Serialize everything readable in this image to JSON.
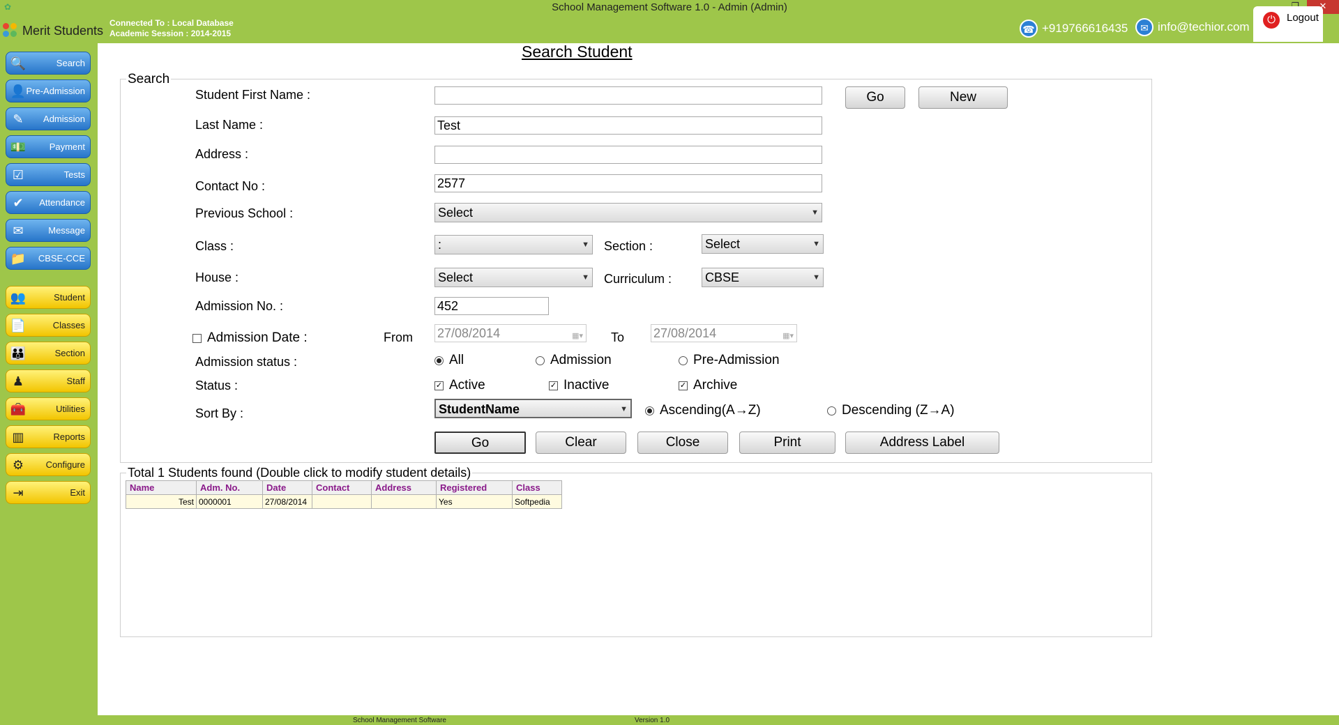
{
  "window": {
    "title": "School Management Software 1.0  -  Admin (Admin)"
  },
  "header": {
    "app_name": "Merit Students",
    "connected_to": "Connected To : Local Database",
    "session": "Academic Session : 2014-2015",
    "phone": "+919766616435",
    "email": "info@techior.com",
    "logout_label": "Logout"
  },
  "sidebar": {
    "blue_items": [
      {
        "label": "Search",
        "icon": "search-icon"
      },
      {
        "label": "Pre-Admission",
        "icon": "person-icon"
      },
      {
        "label": "Admission",
        "icon": "pencil-icon"
      },
      {
        "label": "Payment",
        "icon": "money-icon"
      },
      {
        "label": "Tests",
        "icon": "checklist-icon"
      },
      {
        "label": "Attendance",
        "icon": "attendance-icon"
      },
      {
        "label": "Message",
        "icon": "envelope-icon"
      },
      {
        "label": "CBSE-CCE",
        "icon": "folder-icon"
      }
    ],
    "yellow_items": [
      {
        "label": "Student",
        "icon": "students-icon"
      },
      {
        "label": "Classes",
        "icon": "document-icon"
      },
      {
        "label": "Section",
        "icon": "group-icon"
      },
      {
        "label": "Staff",
        "icon": "staff-icon"
      },
      {
        "label": "Utilities",
        "icon": "toolbox-icon"
      },
      {
        "label": "Reports",
        "icon": "chart-icon"
      },
      {
        "label": "Configure",
        "icon": "gear-icon"
      },
      {
        "label": "Exit",
        "icon": "exit-icon"
      }
    ]
  },
  "page": {
    "title": "Search Student",
    "search_legend": "Search"
  },
  "form": {
    "first_name": {
      "label": "Student First Name :",
      "value": ""
    },
    "last_name": {
      "label": "Last Name :",
      "value": "Test"
    },
    "address": {
      "label": "Address :",
      "value": ""
    },
    "contact": {
      "label": "Contact No :",
      "value": "2577"
    },
    "previous_school": {
      "label": "Previous School :",
      "value": "Select"
    },
    "class": {
      "label": "Class :",
      "value": ":"
    },
    "section": {
      "label": "Section :",
      "value": "Select"
    },
    "house": {
      "label": "House :",
      "value": "Select"
    },
    "curriculum": {
      "label": "Curriculum :",
      "value": "CBSE"
    },
    "admission_no": {
      "label": "Admission No. :",
      "value": "452"
    },
    "admission_date": {
      "label": "Admission Date :",
      "from_label": "From",
      "from": "27/08/2014",
      "to_label": "To",
      "to": "27/08/2014"
    },
    "admission_status": {
      "label": "Admission status :",
      "options": [
        "All",
        "Admission",
        "Pre-Admission"
      ],
      "selected": "All"
    },
    "status": {
      "label": "Status :",
      "active": "Active",
      "inactive": "Inactive",
      "archive": "Archive"
    },
    "sort_by": {
      "label": "Sort By :",
      "value": "StudentName",
      "asc": "Ascending(A→Z)",
      "desc": "Descending (Z→A)"
    }
  },
  "buttons": {
    "go_top": "Go",
    "new": "New",
    "go": "Go",
    "clear": "Clear",
    "close": "Close",
    "print": "Print",
    "address_label": "Address Label"
  },
  "results": {
    "legend": "Total 1 Students found (Double click to modify student details)",
    "columns": [
      "Name",
      "Adm. No.",
      "Date",
      "Contact",
      "Address",
      "Registered",
      "Class"
    ],
    "rows": [
      [
        "Test",
        "0000001",
        "27/08/2014",
        "",
        "",
        "Yes",
        "Softpedia"
      ]
    ]
  },
  "statusbar": {
    "left": "School Management Software",
    "right": "Version 1.0"
  },
  "colors": {
    "chrome_green": "#9ec64a",
    "nav_blue": "#2775c9",
    "nav_yellow": "#f2c500",
    "header_purple": "#8a1a8a"
  }
}
